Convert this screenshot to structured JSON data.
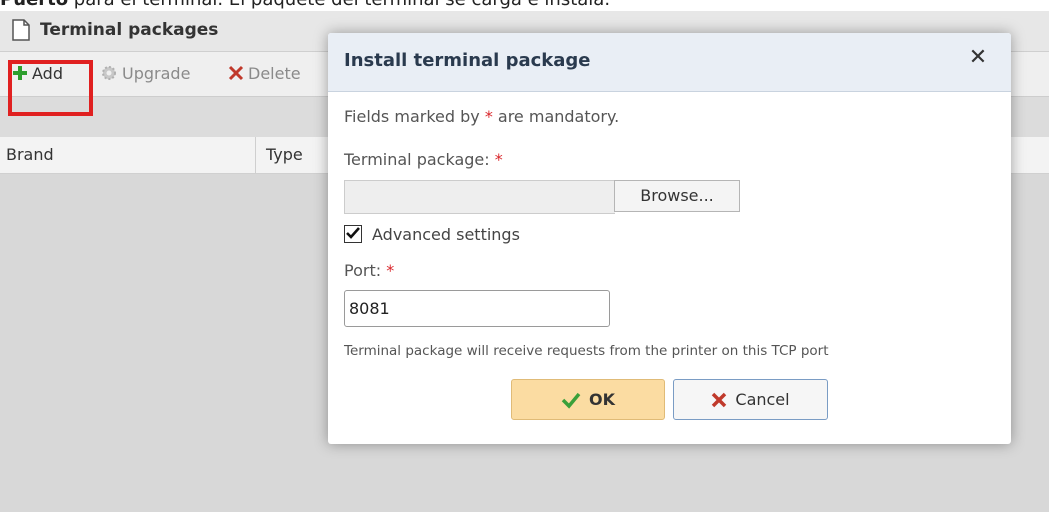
{
  "doc": {
    "bold_word": "Puerto",
    "rest": " para el terminal. El paquete del terminal se carga e instala."
  },
  "panel": {
    "title": "Terminal packages"
  },
  "toolbar": {
    "add": "Add",
    "upgrade": "Upgrade",
    "delete": "Delete"
  },
  "columns": [
    "Brand",
    "Type"
  ],
  "dialog": {
    "title": "Install terminal package",
    "mandatory_note_prefix": "Fields marked by ",
    "mandatory_note_suffix": " are mandatory.",
    "required_mark": "*",
    "package_label": "Terminal package:",
    "package_value": "",
    "browse_label": "Browse...",
    "advanced_label": "Advanced settings",
    "advanced_checked": true,
    "port_label": "Port:",
    "port_value": "8081",
    "port_hint": "Terminal package will receive requests from the printer on this TCP port",
    "ok_label": "OK",
    "cancel_label": "Cancel"
  },
  "colors": {
    "highlight": "#e02020",
    "ok_bg": "#fbdca2",
    "required": "#d9262b"
  }
}
